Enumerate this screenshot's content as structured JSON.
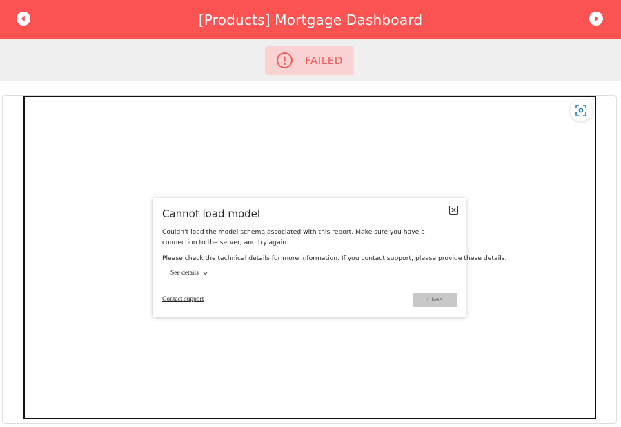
{
  "header": {
    "title": "[Products] Mortgage Dashboard",
    "prev_icon": "chevron-left-circle-icon",
    "next_icon": "chevron-right-circle-icon",
    "background": "#fb5252"
  },
  "status": {
    "label": "FAILED",
    "icon": "alert-circle-icon",
    "color": "#f15a5a",
    "badge_background": "#f9d3d3"
  },
  "viewer": {
    "focus_icon": "focus-mode-icon"
  },
  "dialog": {
    "title": "Cannot load model",
    "message": "Couldn't load the model schema associated with this report. Make sure you have a connection to the server, and try again.",
    "details_hint": "Please check the technical details for more information. If you contact support, please provide these details.",
    "see_details_label": "See details",
    "contact_support_label": "Contact support",
    "close_label": "Close",
    "close_icon": "close-icon"
  }
}
